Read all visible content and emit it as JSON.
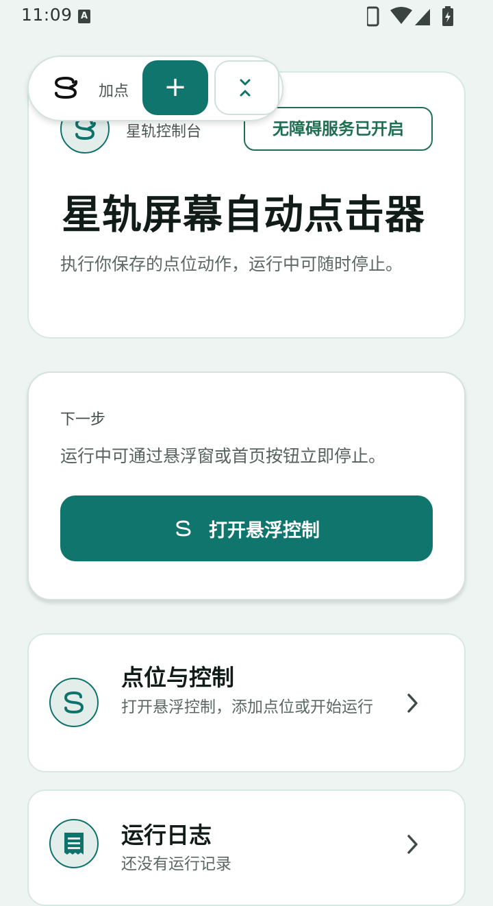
{
  "status": {
    "time": "11:09",
    "indicator": "A"
  },
  "header": {
    "console_label": "星轨控制台",
    "accessibility_badge": "无障碍服务已开启",
    "title": "星轨屏幕自动点击器",
    "description": "执行你保存的点位动作，运行中可随时停止。"
  },
  "next_step": {
    "label": "下一步",
    "description": "运行中可通过悬浮窗或首页按钮立即停止。",
    "button_label": "打开悬浮控制"
  },
  "menu": [
    {
      "title": "点位与控制",
      "subtitle": "打开悬浮控制，添加点位或开始运行",
      "icon": "logo-icon"
    },
    {
      "title": "运行日志",
      "subtitle": "还没有运行记录",
      "icon": "receipt-icon"
    }
  ],
  "float_bar": {
    "label": "加点",
    "add_symbol": "+",
    "collapse_icon": "collapse-icon"
  },
  "colors": {
    "accent": "#10756c",
    "background": "#eef4f2",
    "badge": "#1e6f52"
  }
}
